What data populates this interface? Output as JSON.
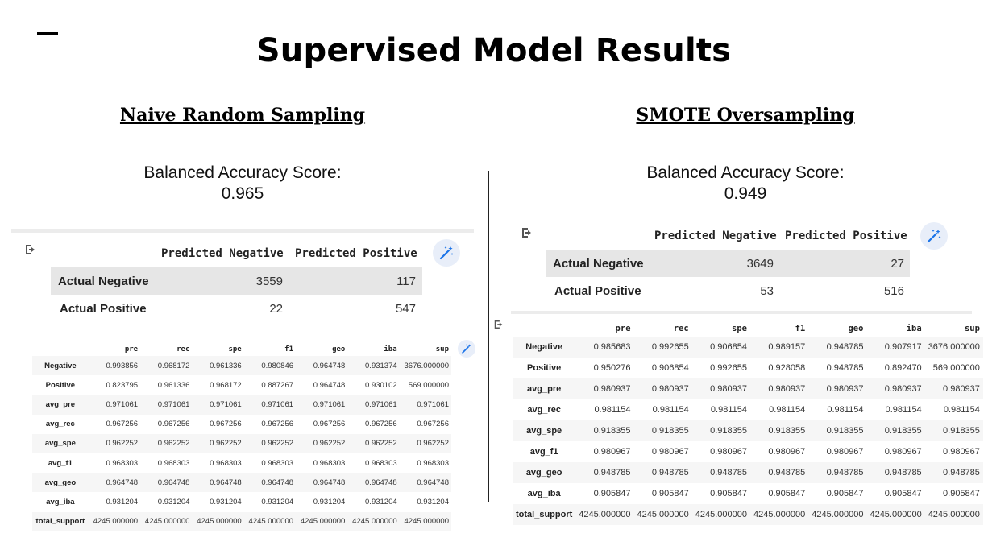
{
  "slide": {
    "title": "Supervised Model Results"
  },
  "left": {
    "heading": "Naive Random Sampling",
    "bas_label": "Balanced Accuracy Score:",
    "bas_value": "0.965",
    "confusion": {
      "col_headers": [
        "Predicted Negative",
        "Predicted Positive"
      ],
      "rows": [
        {
          "label": "Actual Negative",
          "values": [
            "3559",
            "117"
          ]
        },
        {
          "label": "Actual Positive",
          "values": [
            "22",
            "547"
          ]
        }
      ]
    },
    "report": {
      "columns": [
        "pre",
        "rec",
        "spe",
        "f1",
        "geo",
        "iba",
        "sup"
      ],
      "rows": [
        {
          "label": "Negative",
          "values": [
            "0.993856",
            "0.968172",
            "0.961336",
            "0.980846",
            "0.964748",
            "0.931374",
            "3676.000000"
          ]
        },
        {
          "label": "Positive",
          "values": [
            "0.823795",
            "0.961336",
            "0.968172",
            "0.887267",
            "0.964748",
            "0.930102",
            "569.000000"
          ]
        },
        {
          "label": "avg_pre",
          "values": [
            "0.971061",
            "0.971061",
            "0.971061",
            "0.971061",
            "0.971061",
            "0.971061",
            "0.971061"
          ]
        },
        {
          "label": "avg_rec",
          "values": [
            "0.967256",
            "0.967256",
            "0.967256",
            "0.967256",
            "0.967256",
            "0.967256",
            "0.967256"
          ]
        },
        {
          "label": "avg_spe",
          "values": [
            "0.962252",
            "0.962252",
            "0.962252",
            "0.962252",
            "0.962252",
            "0.962252",
            "0.962252"
          ]
        },
        {
          "label": "avg_f1",
          "values": [
            "0.968303",
            "0.968303",
            "0.968303",
            "0.968303",
            "0.968303",
            "0.968303",
            "0.968303"
          ]
        },
        {
          "label": "avg_geo",
          "values": [
            "0.964748",
            "0.964748",
            "0.964748",
            "0.964748",
            "0.964748",
            "0.964748",
            "0.964748"
          ]
        },
        {
          "label": "avg_iba",
          "values": [
            "0.931204",
            "0.931204",
            "0.931204",
            "0.931204",
            "0.931204",
            "0.931204",
            "0.931204"
          ]
        },
        {
          "label": "total_support",
          "values": [
            "4245.000000",
            "4245.000000",
            "4245.000000",
            "4245.000000",
            "4245.000000",
            "4245.000000",
            "4245.000000"
          ]
        }
      ]
    }
  },
  "right": {
    "heading": "SMOTE Oversampling",
    "bas_label": "Balanced Accuracy Score:",
    "bas_value": "0.949",
    "confusion": {
      "col_headers": [
        "Predicted Negative",
        "Predicted Positive"
      ],
      "rows": [
        {
          "label": "Actual Negative",
          "values": [
            "3649",
            "27"
          ]
        },
        {
          "label": "Actual Positive",
          "values": [
            "53",
            "516"
          ]
        }
      ]
    },
    "report": {
      "columns": [
        "pre",
        "rec",
        "spe",
        "f1",
        "geo",
        "iba",
        "sup"
      ],
      "rows": [
        {
          "label": "Negative",
          "values": [
            "0.985683",
            "0.992655",
            "0.906854",
            "0.989157",
            "0.948785",
            "0.907917",
            "3676.000000"
          ]
        },
        {
          "label": "Positive",
          "values": [
            "0.950276",
            "0.906854",
            "0.992655",
            "0.928058",
            "0.948785",
            "0.892470",
            "569.000000"
          ]
        },
        {
          "label": "avg_pre",
          "values": [
            "0.980937",
            "0.980937",
            "0.980937",
            "0.980937",
            "0.980937",
            "0.980937",
            "0.980937"
          ]
        },
        {
          "label": "avg_rec",
          "values": [
            "0.981154",
            "0.981154",
            "0.981154",
            "0.981154",
            "0.981154",
            "0.981154",
            "0.981154"
          ]
        },
        {
          "label": "avg_spe",
          "values": [
            "0.918355",
            "0.918355",
            "0.918355",
            "0.918355",
            "0.918355",
            "0.918355",
            "0.918355"
          ]
        },
        {
          "label": "avg_f1",
          "values": [
            "0.980967",
            "0.980967",
            "0.980967",
            "0.980967",
            "0.980967",
            "0.980967",
            "0.980967"
          ]
        },
        {
          "label": "avg_geo",
          "values": [
            "0.948785",
            "0.948785",
            "0.948785",
            "0.948785",
            "0.948785",
            "0.948785",
            "0.948785"
          ]
        },
        {
          "label": "avg_iba",
          "values": [
            "0.905847",
            "0.905847",
            "0.905847",
            "0.905847",
            "0.905847",
            "0.905847",
            "0.905847"
          ]
        },
        {
          "label": "total_support",
          "values": [
            "4245.000000",
            "4245.000000",
            "4245.000000",
            "4245.000000",
            "4245.000000",
            "4245.000000",
            "4245.000000"
          ]
        }
      ]
    }
  },
  "icons": {
    "output": "output-arrow-icon",
    "wand": "magic-wand-icon",
    "accent": "#1a73e8",
    "wand_bg": "#e8eef9"
  }
}
